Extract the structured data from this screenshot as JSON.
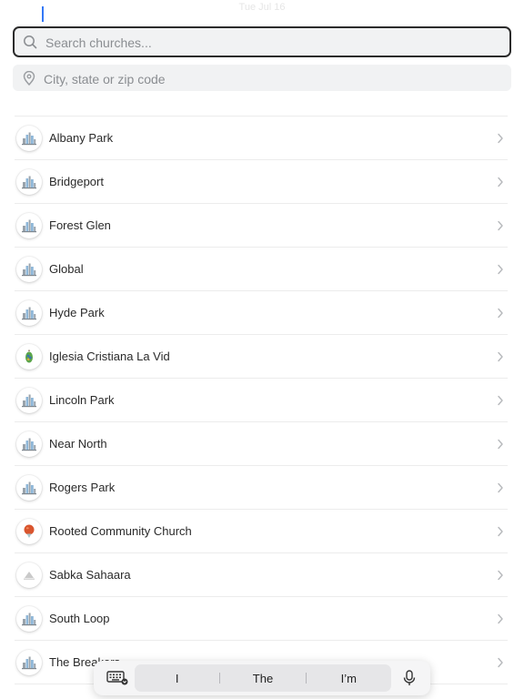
{
  "status_bar": {
    "center": "Tue Jul 16"
  },
  "search": {
    "placeholder": "Search churches...",
    "value": ""
  },
  "location": {
    "placeholder": "City, state or zip code",
    "value": ""
  },
  "churches": [
    {
      "name": "Albany Park",
      "logo": "skyline"
    },
    {
      "name": "Bridgeport",
      "logo": "skyline"
    },
    {
      "name": "Forest Glen",
      "logo": "skyline"
    },
    {
      "name": "Global",
      "logo": "skyline"
    },
    {
      "name": "Hyde Park",
      "logo": "skyline"
    },
    {
      "name": "Iglesia Cristiana La Vid",
      "logo": "vine"
    },
    {
      "name": "Lincoln Park",
      "logo": "skyline"
    },
    {
      "name": "Near North",
      "logo": "skyline"
    },
    {
      "name": "Rogers Park",
      "logo": "skyline"
    },
    {
      "name": "Rooted Community Church",
      "logo": "balloon"
    },
    {
      "name": "Sabka Sahaara",
      "logo": "gray-mark"
    },
    {
      "name": "South Loop",
      "logo": "skyline"
    },
    {
      "name": "The Breakers",
      "logo": "skyline"
    }
  ],
  "keyboard_bar": {
    "suggestions": [
      "I",
      "The",
      "I’m"
    ],
    "icons": [
      "keyboard-dismiss-icon",
      "microphone-icon"
    ]
  },
  "colors": {
    "caret": "#3478f6",
    "divider": "#ececec",
    "field_background": "#f1f2f3",
    "skyline_blue": "#8fb7d8",
    "skyline_gray": "#9aa3ab"
  }
}
